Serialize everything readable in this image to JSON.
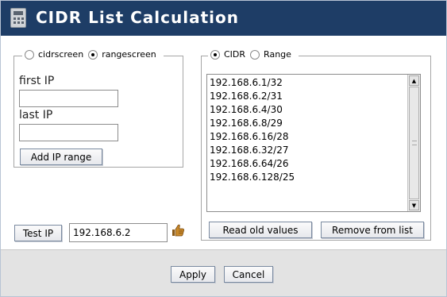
{
  "window": {
    "title": "CIDR List Calculation"
  },
  "mode_group": {
    "options": [
      {
        "label": "cidrscreen",
        "selected": false
      },
      {
        "label": "rangescreen",
        "selected": true
      }
    ],
    "first_ip_label": "first IP",
    "first_ip_value": "",
    "last_ip_label": "last IP",
    "last_ip_value": "",
    "add_range_button": "Add IP range"
  },
  "view_group": {
    "options": [
      {
        "label": "CIDR",
        "selected": true
      },
      {
        "label": "Range",
        "selected": false
      }
    ],
    "list_items": [
      "192.168.6.1/32",
      "192.168.6.2/31",
      "192.168.6.4/30",
      "192.168.6.8/29",
      "192.168.6.16/28",
      "192.168.6.32/27",
      "192.168.6.64/26",
      "192.168.6.128/25"
    ],
    "read_old_values_button": "Read old values",
    "remove_from_list_button": "Remove from list"
  },
  "test": {
    "button": "Test IP",
    "value": "192.168.6.2",
    "result_icon": "thumbs-up-icon"
  },
  "footer": {
    "apply_button": "Apply",
    "cancel_button": "Cancel"
  },
  "colors": {
    "titlebar": "#1e3d66",
    "title_text": "#ffffff",
    "footer_bg": "#e3e3e3",
    "thumb_icon": "#c8892a"
  }
}
